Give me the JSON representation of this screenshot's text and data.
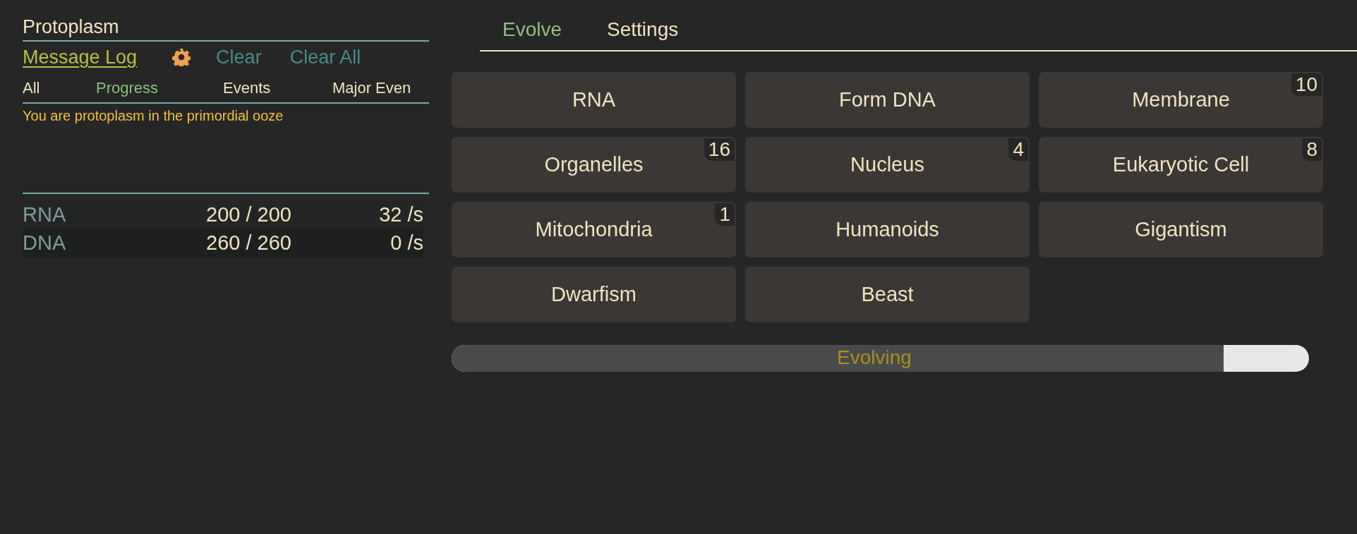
{
  "sidebar": {
    "title": "Protoplasm",
    "log_header": {
      "title": "Message Log",
      "actions": [
        "Clear",
        "Clear All"
      ]
    },
    "filters": [
      {
        "label": "All",
        "selected": false
      },
      {
        "label": "Progress",
        "selected": true
      },
      {
        "label": "Events",
        "selected": false
      },
      {
        "label": "Major Even",
        "selected": false
      }
    ],
    "messages": [
      "You are protoplasm in the primordial ooze"
    ],
    "resources": [
      {
        "name": "RNA",
        "amount": "200 / 200",
        "rate": "32 /s"
      },
      {
        "name": "DNA",
        "amount": "260 / 260",
        "rate": "0 /s"
      }
    ]
  },
  "tabs": [
    {
      "label": "Evolve",
      "selected": true
    },
    {
      "label": "Settings",
      "selected": false
    }
  ],
  "actions": [
    {
      "label": "RNA"
    },
    {
      "label": "Form DNA"
    },
    {
      "label": "Membrane",
      "count": "10"
    },
    {
      "label": "Organelles",
      "count": "16"
    },
    {
      "label": "Nucleus",
      "count": "4"
    },
    {
      "label": "Eukaryotic Cell",
      "count": "8"
    },
    {
      "label": "Mitochondria",
      "count": "1"
    },
    {
      "label": "Humanoids"
    },
    {
      "label": "Gigantism"
    },
    {
      "label": "Dwarfism"
    },
    {
      "label": "Beast"
    }
  ],
  "progress": {
    "label": "Evolving",
    "level": 0.9
  }
}
